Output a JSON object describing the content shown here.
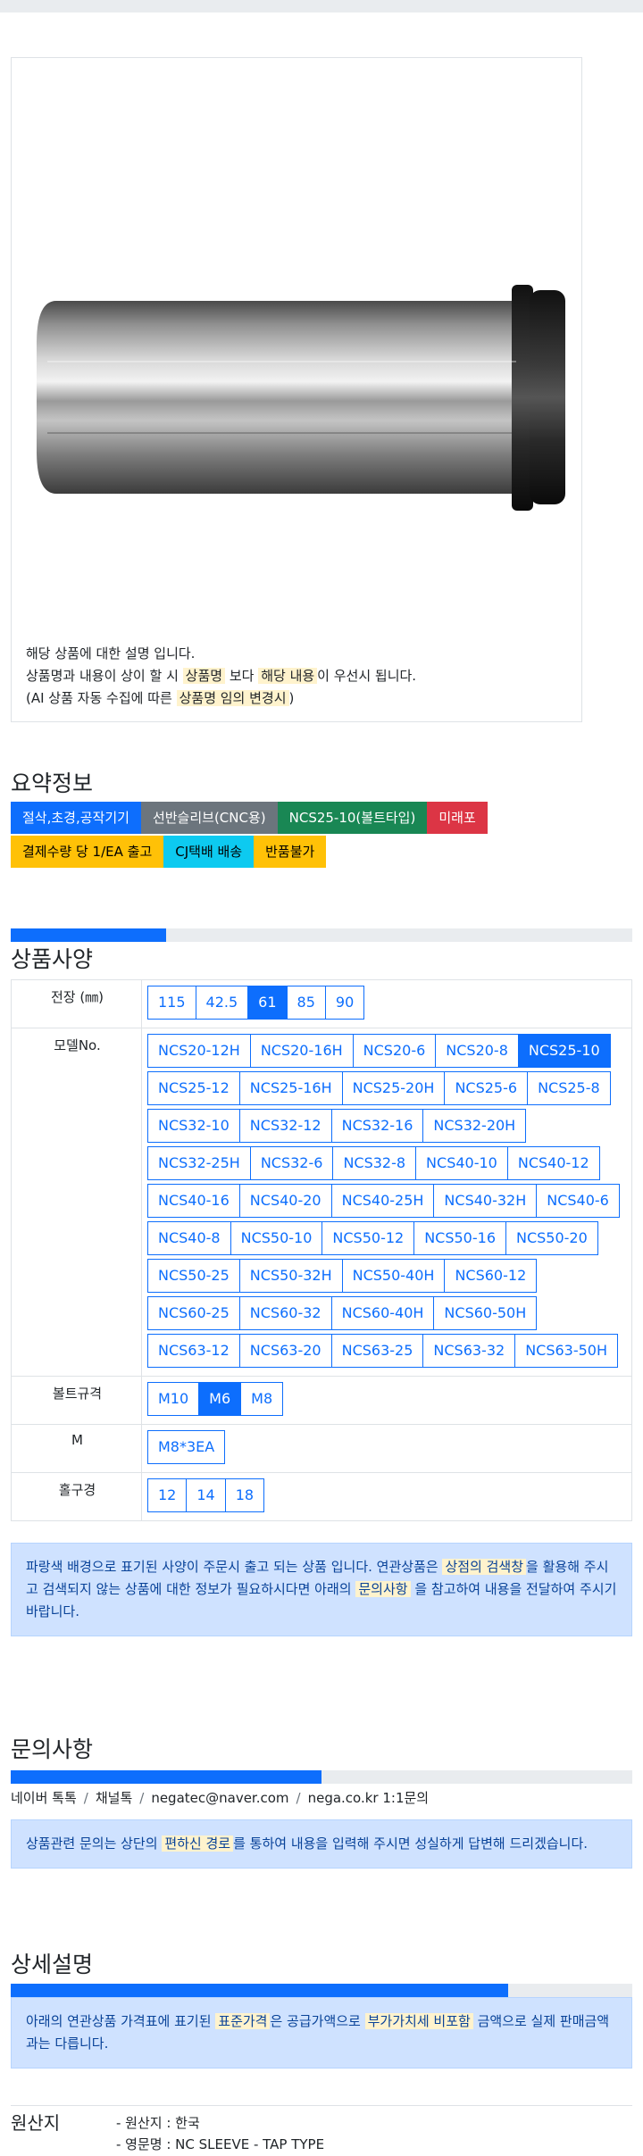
{
  "product": {
    "description_lines": [
      {
        "parts": [
          {
            "text": "해당 상품에 대한 설명 입니다.",
            "hl": false
          }
        ]
      },
      {
        "parts": [
          {
            "text": "상품명과 내용이 상이 할 시 ",
            "hl": false
          },
          {
            "text": "상품명",
            "hl": true
          },
          {
            "text": " 보다 ",
            "hl": false
          },
          {
            "text": "해당 내용",
            "hl": true
          },
          {
            "text": "이 우선시 됩니다.",
            "hl": false
          }
        ]
      },
      {
        "parts": [
          {
            "text": "(AI 상품 자동 수집에 따른 ",
            "hl": false
          },
          {
            "text": "상품명 임의 변경시",
            "hl": true
          },
          {
            "text": ")",
            "hl": false
          }
        ]
      }
    ]
  },
  "summary": {
    "title": "요약정보",
    "badges_row1": [
      {
        "label": "절삭,초경,공작기기",
        "style": "primary"
      },
      {
        "label": "선반슬리브(CNC용)",
        "style": "secondary"
      },
      {
        "label": "NCS25-10(볼트타입)",
        "style": "success"
      },
      {
        "label": "미래포",
        "style": "danger"
      }
    ],
    "badges_row2": [
      {
        "label": "결제수량 당 1/EA 출고",
        "style": "warning"
      },
      {
        "label": "CJ택배 배송",
        "style": "info"
      },
      {
        "label": "반품불가",
        "style": "warning"
      }
    ]
  },
  "spec": {
    "title": "상품사양",
    "progress": 0.25,
    "rows": [
      {
        "label": "전장 (㎜)",
        "options": [
          "115",
          "42.5",
          "61",
          "85",
          "90"
        ],
        "selected": "61"
      },
      {
        "label": "모델No.",
        "options": [
          "NCS20-12H",
          "NCS20-16H",
          "NCS20-6",
          "NCS20-8",
          "NCS25-10",
          "NCS25-12",
          "NCS25-16H",
          "NCS25-20H",
          "NCS25-6",
          "NCS25-8",
          "NCS32-10",
          "NCS32-12",
          "NCS32-16",
          "NCS32-20H",
          "NCS32-25H",
          "NCS32-6",
          "NCS32-8",
          "NCS40-10",
          "NCS40-12",
          "NCS40-16",
          "NCS40-20",
          "NCS40-25H",
          "NCS40-32H",
          "NCS40-6",
          "NCS40-8",
          "NCS50-10",
          "NCS50-12",
          "NCS50-16",
          "NCS50-20",
          "NCS50-25",
          "NCS50-32H",
          "NCS50-40H",
          "NCS60-12",
          "NCS60-25",
          "NCS60-32",
          "NCS60-40H",
          "NCS60-50H",
          "NCS63-12",
          "NCS63-20",
          "NCS63-25",
          "NCS63-32",
          "NCS63-50H"
        ],
        "selected": "NCS25-10"
      },
      {
        "label": "볼트규격",
        "options": [
          "M10",
          "M6",
          "M8"
        ],
        "selected": "M6"
      },
      {
        "label": "M",
        "options": [
          "M8*3EA"
        ],
        "selected": ""
      },
      {
        "label": "홀구경",
        "options": [
          "12",
          "14",
          "18"
        ],
        "selected": ""
      }
    ],
    "notice": [
      {
        "text": "파랑색 배경으로 표기된 사양이 주문시 출고 되는 상품 입니다. 연관상품은 ",
        "hl": false
      },
      {
        "text": "상점의 검색창",
        "hl": true
      },
      {
        "text": "을 활용해 주시고 검색되지 않는 상품에 대한 정보가 필요하시다면 아래의 ",
        "hl": false
      },
      {
        "text": "문의사항",
        "hl": true
      },
      {
        "text": " 을 참고하여 내용을 전달하여 주시기 바랍니다.",
        "hl": false
      }
    ]
  },
  "inquiry": {
    "title": "문의사항",
    "progress": 0.5,
    "contacts": [
      "네이버 톡톡",
      "채널톡",
      "negatec@naver.com",
      "nega.co.kr 1:1문의"
    ],
    "notice": [
      {
        "text": "상품관련 문의는 상단의 ",
        "hl": false
      },
      {
        "text": "편하신 경로",
        "hl": true
      },
      {
        "text": "를 통하여 내용을 입력해 주시면 성실하게 답변해 드리겠습니다.",
        "hl": false
      }
    ]
  },
  "detail": {
    "title": "상세설명",
    "progress": 0.8,
    "notice": [
      {
        "text": "아래의 연관상품 가격표에 표기된 ",
        "hl": false
      },
      {
        "text": "표준가격",
        "hl": true
      },
      {
        "text": "은 공급가액으로 ",
        "hl": false
      },
      {
        "text": "부가가치세 비포함",
        "hl": true
      },
      {
        "text": " 금액으로 실제 판매금액과는 다릅니다.",
        "hl": false
      }
    ]
  },
  "origin": {
    "label": "원산지",
    "items": [
      "- 원산지 : 한국",
      "- 영문명 : NC SLEEVE - TAP TYPE"
    ]
  }
}
